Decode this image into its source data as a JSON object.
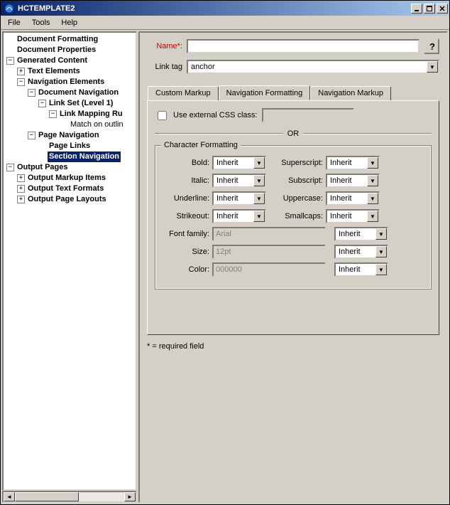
{
  "window": {
    "title": "HCTEMPLATE2",
    "min": "_",
    "max": "□",
    "close": "×"
  },
  "menu": {
    "file": "File",
    "tools": "Tools",
    "help": "Help"
  },
  "tree": {
    "items": [
      {
        "indent": 0,
        "exp": "",
        "bold": true,
        "label": "Document Formatting"
      },
      {
        "indent": 0,
        "exp": "",
        "bold": true,
        "label": "Document Properties"
      },
      {
        "indent": 0,
        "exp": "-",
        "bold": true,
        "label": "Generated Content"
      },
      {
        "indent": 1,
        "exp": "+",
        "bold": true,
        "label": "Text Elements"
      },
      {
        "indent": 1,
        "exp": "-",
        "bold": true,
        "label": "Navigation Elements"
      },
      {
        "indent": 2,
        "exp": "-",
        "bold": true,
        "label": "Document Navigation"
      },
      {
        "indent": 3,
        "exp": "-",
        "bold": true,
        "label": "Link Set (Level 1)"
      },
      {
        "indent": 4,
        "exp": "-",
        "bold": true,
        "label": "Link Mapping Ru"
      },
      {
        "indent": 5,
        "exp": "",
        "bold": false,
        "label": "Match on outlin"
      },
      {
        "indent": 2,
        "exp": "-",
        "bold": true,
        "label": "Page Navigation"
      },
      {
        "indent": 3,
        "exp": "",
        "bold": true,
        "label": "Page Links"
      },
      {
        "indent": 3,
        "exp": "",
        "bold": true,
        "label": "Section Navigation",
        "selected": true
      },
      {
        "indent": 0,
        "exp": "-",
        "bold": true,
        "label": "Output Pages"
      },
      {
        "indent": 1,
        "exp": "+",
        "bold": true,
        "label": "Output Markup Items"
      },
      {
        "indent": 1,
        "exp": "+",
        "bold": true,
        "label": "Output Text Formats"
      },
      {
        "indent": 1,
        "exp": "+",
        "bold": true,
        "label": "Output Page Layouts"
      }
    ]
  },
  "form": {
    "name_label": "Name*:",
    "name_value": "",
    "linktag_label": "Link tag",
    "linktag_value": "anchor",
    "help": "?"
  },
  "tabs": {
    "t0": "Custom Markup",
    "t1": "Navigation Formatting",
    "t2": "Navigation Markup"
  },
  "navfmt": {
    "use_external_css": "Use external CSS class:",
    "or": "OR",
    "char_formatting": "Character Formatting",
    "bold": "Bold:",
    "italic": "Italic:",
    "underline": "Underline:",
    "strikeout": "Strikeout:",
    "superscript": "Superscript:",
    "subscript": "Subscript:",
    "uppercase": "Uppercase:",
    "smallcaps": "Smallcaps:",
    "fontfamily": "Font family:",
    "size": "Size:",
    "color": "Color:",
    "inherit": "Inherit",
    "arial": "Arial",
    "sz12": "12pt",
    "col000": "000000"
  },
  "footnote": "* = required field"
}
